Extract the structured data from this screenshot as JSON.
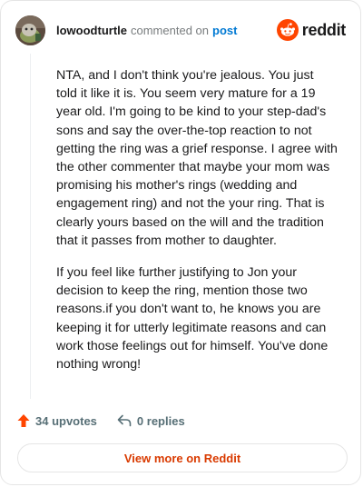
{
  "comment": {
    "author": "lowoodturtle",
    "action_text": "commented on",
    "post_link": "post",
    "paragraphs": [
      "NTA, and I don't think you're jealous. You just told it like it is. You seem very mature for a 19 year old. I'm going to be kind to your step-dad's sons and say the over-the-top reaction to not getting the ring was a grief response. I agree with the other commenter that maybe your mom was promising his mother's rings (wedding and engagement ring) and not the your ring. That is clearly yours based on the will and the tradition that it passes from mother to daughter.",
      "If you feel like further justifying to Jon your decision to keep the ring, mention those two reasons.if you don't want to, he knows you are keeping it for utterly legitimate reasons and can work those feelings out for himself. You've done nothing wrong!"
    ]
  },
  "brand": {
    "name": "reddit",
    "icon": "reddit-logo-icon",
    "color": "#ff4500"
  },
  "stats": {
    "upvotes_label": "34 upvotes",
    "upvote_icon": "upvote-arrow-icon",
    "replies_label": "0 replies",
    "reply_icon": "reply-arrow-icon"
  },
  "actions": {
    "view_more_label": "View more on Reddit"
  },
  "colors": {
    "accent": "#d93a00",
    "link": "#0079d3",
    "upvote": "#ff4500"
  }
}
